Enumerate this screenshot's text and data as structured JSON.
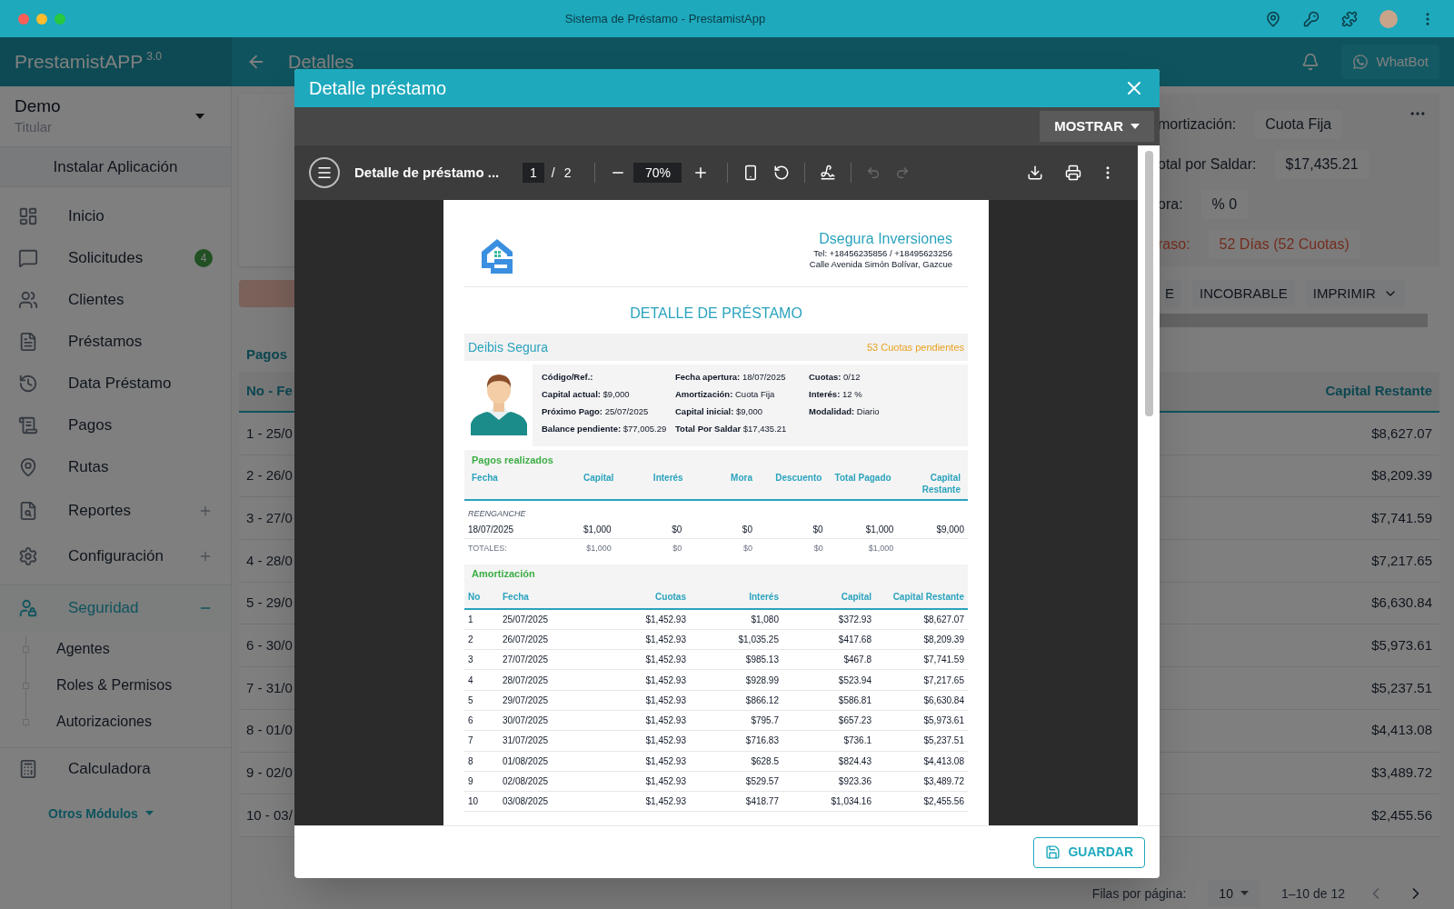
{
  "window": {
    "title": "Sistema de Préstamo - PrestamistApp"
  },
  "app_bar": {
    "brand": "PrestamistAPP",
    "version": "3.0",
    "page_title": "Detalles",
    "whatbot": "WhatBot"
  },
  "sidebar": {
    "account": {
      "name": "Demo",
      "role": "Titular"
    },
    "install_button": "Instalar Aplicación",
    "items": [
      {
        "label": "Inicio",
        "kind": "link"
      },
      {
        "label": "Solicitudes",
        "kind": "link",
        "badge": "4"
      },
      {
        "label": "Clientes",
        "kind": "link"
      },
      {
        "label": "Préstamos",
        "kind": "link"
      },
      {
        "label": "Data Préstamo",
        "kind": "link"
      },
      {
        "label": "Pagos",
        "kind": "link"
      },
      {
        "label": "Rutas",
        "kind": "link"
      },
      {
        "label": "Reportes",
        "kind": "group",
        "expanded": false
      },
      {
        "label": "Configuración",
        "kind": "group",
        "expanded": false
      },
      {
        "label": "Seguridad",
        "kind": "group",
        "expanded": true,
        "children": [
          {
            "label": "Agentes"
          },
          {
            "label": "Roles & Permisos"
          },
          {
            "label": "Autorizaciones"
          }
        ]
      },
      {
        "label": "Calculadora",
        "kind": "link"
      }
    ],
    "more": "Otros Módulos"
  },
  "loan_summary": [
    {
      "label": "mortización:",
      "value": "Cuota Fija",
      "kind": "normal"
    },
    {
      "label": "otal por Saldar:",
      "value": "$17,435.21",
      "kind": "normal"
    },
    {
      "label": "ora:",
      "value": "% 0",
      "kind": "normal"
    },
    {
      "label": "raso:",
      "value": "52 Días (52 Cuotas)",
      "kind": "alert"
    }
  ],
  "actions": [
    {
      "label": "E",
      "kind": "button"
    },
    {
      "label": "INCOBRABLE",
      "kind": "button"
    },
    {
      "label": "IMPRIMIR",
      "kind": "dropdown"
    }
  ],
  "payments_table": {
    "tab": "Pagos",
    "columns": [
      "No - Fe",
      "Capital Restante"
    ],
    "rows": [
      [
        "1 - 25/0",
        "$8,627.07"
      ],
      [
        "2 - 26/0",
        "$8,209.39"
      ],
      [
        "3 - 27/0",
        "$7,741.59"
      ],
      [
        "4 - 28/0",
        "$7,217.65"
      ],
      [
        "5 - 29/0",
        "$6,630.84"
      ],
      [
        "6 - 30/0",
        "$5,973.61"
      ],
      [
        "7 - 31/0",
        "$5,237.51"
      ],
      [
        "8 - 01/0",
        "$4,413.08"
      ],
      [
        "9 - 02/0",
        "$3,489.72"
      ],
      [
        "10 - 03/",
        "$2,455.56"
      ]
    ]
  },
  "pagination": {
    "rows_per_page_label": "Filas por página:",
    "rows_per_page": "10",
    "range": "1–10 de 12"
  },
  "dialog": {
    "title": "Detalle préstamo",
    "show_button": "MOSTRAR",
    "save_button": "GUARDAR",
    "viewer": {
      "file_name": "Detalle de préstamo ...",
      "page": "1",
      "page_separator": "/",
      "page_count": "2",
      "zoom": "70%",
      "undo": {
        "disabled": true
      },
      "redo": {
        "disabled": true
      }
    },
    "document": {
      "company": {
        "name": "Dsegura Inversiones",
        "phone": "Tel: +18456235856 / +18495623256",
        "address": "Calle Avenida Simón Bolívar, Gazcue"
      },
      "title": "DETALLE DE PRÉSTAMO",
      "client": {
        "name": "Deibis Segura",
        "pending": "53 Cuotas pendientes"
      },
      "details": [
        [
          "**Código/Ref.:**",
          "**Capital actual:** $9,000",
          "**Próximo Pago:** 25/07/2025",
          "**Balance pendiente:** $77,005.29"
        ],
        [
          "**Fecha apertura:** 18/07/2025",
          "**Amortización:** Cuota Fija",
          "**Capital inicial:** $9,000",
          "**Total Por Saldar** $17,435.21"
        ],
        [
          "**Cuotas:** 0/12",
          "**Interés:** 12 %",
          "**Modalidad:** Diario"
        ]
      ],
      "payments": {
        "title": "Pagos realizados",
        "columns": [
          "Fecha",
          "Capital",
          "Interés",
          "Mora",
          "Descuento",
          "Total Pagado",
          "Capital Restante"
        ],
        "group": "REENGANCHE",
        "rows": [
          [
            "18/07/2025",
            "$1,000",
            "$0",
            "$0",
            "$0",
            "$1,000",
            "$9,000"
          ]
        ],
        "totals": [
          "TOTALES:",
          "$1,000",
          "$0",
          "$0",
          "$0",
          "$1,000"
        ]
      },
      "amortization": {
        "title": "Amortización",
        "columns": [
          "No",
          "Fecha",
          "Cuotas",
          "Interés",
          "Capital",
          "Capital Restante"
        ],
        "rows": [
          [
            "1",
            "25/07/2025",
            "$1,452.93",
            "$1,080",
            "$372.93",
            "$8,627.07"
          ],
          [
            "2",
            "26/07/2025",
            "$1,452.93",
            "$1,035.25",
            "$417.68",
            "$8,209.39"
          ],
          [
            "3",
            "27/07/2025",
            "$1,452.93",
            "$985.13",
            "$467.8",
            "$7,741.59"
          ],
          [
            "4",
            "28/07/2025",
            "$1,452.93",
            "$928.99",
            "$523.94",
            "$7,217.65"
          ],
          [
            "5",
            "29/07/2025",
            "$1,452.93",
            "$866.12",
            "$586.81",
            "$6,630.84"
          ],
          [
            "6",
            "30/07/2025",
            "$1,452.93",
            "$795.7",
            "$657.23",
            "$5,973.61"
          ],
          [
            "7",
            "31/07/2025",
            "$1,452.93",
            "$716.83",
            "$736.1",
            "$5,237.51"
          ],
          [
            "8",
            "01/08/2025",
            "$1,452.93",
            "$628.5",
            "$824.43",
            "$4,413.08"
          ],
          [
            "9",
            "02/08/2025",
            "$1,452.93",
            "$529.57",
            "$923.36",
            "$3,489.72"
          ],
          [
            "10",
            "03/08/2025",
            "$1,452.93",
            "$418.77",
            "$1,034.16",
            "$2,455.56"
          ]
        ]
      }
    }
  }
}
